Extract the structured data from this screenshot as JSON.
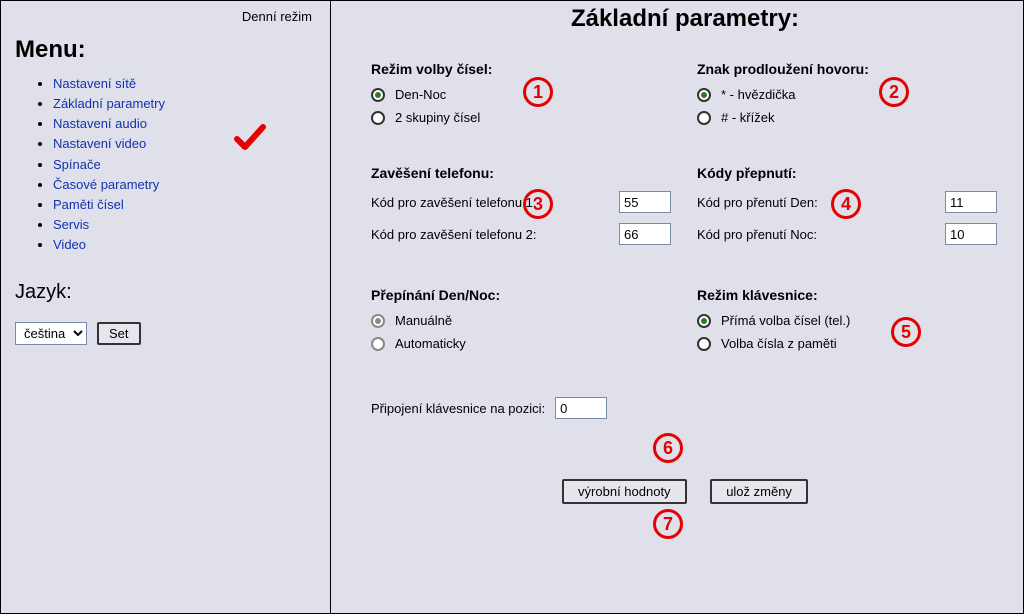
{
  "status_text": "Denní režim",
  "sidebar": {
    "menu_title": "Menu:",
    "items": [
      "Nastavení sítě",
      "Základní parametry",
      "Nastavení audio",
      "Nastavení video",
      "Spínače",
      "Časové parametry",
      "Paměti čísel",
      "Servis",
      "Video"
    ],
    "lang_title": "Jazyk:",
    "lang_selected": "čeština",
    "set_label": "Set"
  },
  "page_title": "Základní parametry:",
  "dial_mode": {
    "title": "Režim volby čísel:",
    "opt1": "Den-Noc",
    "opt2": "2 skupiny čísel"
  },
  "prolong": {
    "title": "Znak prodloužení hovoru:",
    "opt1": "* - hvězdička",
    "opt2": "# - křížek"
  },
  "hangup": {
    "title": "Zavěšení telefonu:",
    "label1": "Kód pro zavěšení telefonu 1:",
    "val1": "55",
    "label2": "Kód pro zavěšení telefonu 2:",
    "val2": "66"
  },
  "switch_codes": {
    "title": "Kódy přepnutí:",
    "label1": "Kód pro přenutí Den:",
    "val1": "11",
    "label2": "Kód pro přenutí Noc:",
    "val2": "10"
  },
  "daynight": {
    "title": "Přepínání Den/Noc:",
    "opt1": "Manuálně",
    "opt2": "Automaticky"
  },
  "keyboard_mode": {
    "title": "Režim klávesnice:",
    "opt1": "Přímá volba čísel (tel.)",
    "opt2": "Volba čísla z paměti"
  },
  "keyboard_pos": {
    "label": "Připojení klávesnice na pozici:",
    "val": "0"
  },
  "buttons": {
    "defaults": "výrobní hodnoty",
    "save": "ulož změny"
  },
  "annotations": [
    "1",
    "2",
    "3",
    "4",
    "5",
    "6",
    "7"
  ]
}
